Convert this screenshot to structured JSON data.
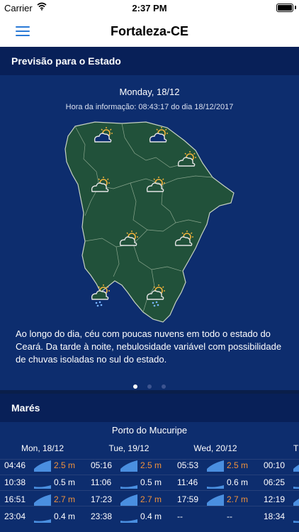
{
  "status_bar": {
    "carrier": "Carrier",
    "time": "2:37 PM"
  },
  "nav": {
    "title": "Fortaleza-CE"
  },
  "forecast": {
    "header": "Previsão para o Estado",
    "date": "Monday, 18/12",
    "info": "Hora da informação: 08:43:17 do dia 18/12/2017",
    "description": "Ao longo do dia, céu com poucas nuvens em todo o estado do Ceará. Da tarde à noite, nebulosidade variável com possibilidade de chuvas isoladas no sul do estado.",
    "page_count": 3,
    "active_page": 1,
    "weather_icons": [
      "partly-cloudy",
      "partly-cloudy",
      "partly-cloudy",
      "partly-cloudy",
      "partly-cloudy",
      "partly-cloudy",
      "partly-cloudy",
      "partly-cloudy-rain",
      "partly-cloudy-rain"
    ],
    "colors": {
      "map_fill": "#21513a",
      "sun": "#f4b43c",
      "rain": "#7ab6ff"
    }
  },
  "tides": {
    "header": "Marés",
    "port": "Porto do Mucuripe",
    "days": [
      {
        "label": "Mon, 18/12",
        "rows": [
          {
            "time": "04:46",
            "height": "2.5 m",
            "type": "high"
          },
          {
            "time": "10:38",
            "height": "0.5 m",
            "type": "low"
          },
          {
            "time": "16:51",
            "height": "2.7 m",
            "type": "high"
          },
          {
            "time": "23:04",
            "height": "0.4 m",
            "type": "low"
          }
        ]
      },
      {
        "label": "Tue, 19/12",
        "rows": [
          {
            "time": "05:16",
            "height": "2.5 m",
            "type": "high"
          },
          {
            "time": "11:06",
            "height": "0.5 m",
            "type": "low"
          },
          {
            "time": "17:23",
            "height": "2.7 m",
            "type": "high"
          },
          {
            "time": "23:38",
            "height": "0.4 m",
            "type": "low"
          }
        ]
      },
      {
        "label": "Wed, 20/12",
        "rows": [
          {
            "time": "05:53",
            "height": "2.5 m",
            "type": "high"
          },
          {
            "time": "11:46",
            "height": "0.6 m",
            "type": "low"
          },
          {
            "time": "17:59",
            "height": "2.7 m",
            "type": "high"
          },
          {
            "time": "--",
            "height": "--",
            "type": "none"
          }
        ]
      },
      {
        "label": "Thu,",
        "rows": [
          {
            "time": "00:10",
            "height": "",
            "type": "high"
          },
          {
            "time": "06:25",
            "height": "",
            "type": "low"
          },
          {
            "time": "12:19",
            "height": "",
            "type": "high"
          },
          {
            "time": "18:34",
            "height": "",
            "type": "low"
          }
        ]
      }
    ],
    "colors": {
      "high": "#f0923c",
      "low": "#ffffff",
      "wave": "#4a8fe0"
    }
  }
}
